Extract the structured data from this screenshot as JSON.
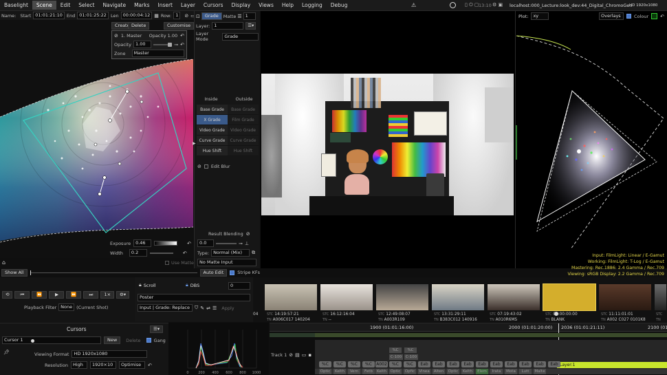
{
  "menu": [
    "Baselight",
    "Scene",
    "Edit",
    "Select",
    "Navigate",
    "Marks",
    "Insert",
    "Layer",
    "Cursors",
    "Display",
    "Views",
    "Help",
    "Logging",
    "Debug"
  ],
  "menu_active": "Scene",
  "status": {
    "time": "13:10",
    "host": "localhost:000_Lecture:look_dev:44_Digital_ChromoGen",
    "format": "HD 1920x1080"
  },
  "shotbar": {
    "name_label": "Name:",
    "start_label": "Start",
    "start": "01:01:21:10",
    "end_label": "End",
    "end": "01:01:25:22",
    "len_label": "Len",
    "len": "00:00:04:12",
    "row_label": "Row:",
    "row": "1"
  },
  "left": {
    "create": "Create",
    "delete": "Delete",
    "customise": "Customise",
    "master_label": "1. Master",
    "opacity_label": "Opacity 1.00",
    "opacity_field_label": "Opacity",
    "opacity": "1.00",
    "zone_label": "Zone",
    "zone": "Master",
    "exposure_label": "Exposure",
    "exposure": "0.46",
    "width_label": "Width",
    "width": "0.2",
    "use_matte": "Use Matte",
    "show_all": "Show All",
    "auto_edit": "Auto Edit",
    "stripe_kfs": "Stripe KFs"
  },
  "grade": {
    "tab_grade": "Grade",
    "tab_matte": "Matte",
    "layer_label": "Layer:",
    "layer": "1",
    "layer_mode_label": "Layer Mode",
    "layer_mode": "Grade",
    "layer_sel": "1",
    "inside": "Inside",
    "outside": "Outside",
    "rows": [
      [
        "Base Grade",
        "Base Grade"
      ],
      [
        "X Grade",
        "Film Grade"
      ],
      [
        "Video Grade",
        "Video Grade"
      ],
      [
        "Curve Grade",
        "Curve Grade"
      ],
      [
        "Hue Shift",
        "Hue Shift"
      ]
    ],
    "edit_blur": "Edit Blur",
    "result_blending": "Result Blending",
    "blend_value": "0.0",
    "type_label": "Type:",
    "type": "Normal (Mix)",
    "matte_input": "No Matte Input"
  },
  "plot": {
    "label": "Plot:",
    "mode": "xy",
    "overlays": "Overlays",
    "colour": "Colour",
    "legend": [
      "Input: FilmLight: Linear / E-Gamut",
      "Working: FilmLight: T-Log / E-Gamut",
      "Mastering: Rec.1886: 2.4 Gamma / Rec.709",
      "Viewing: sRGB Display: 2.2 Gamma / Rec.709"
    ],
    "legend_colors": [
      "#e6d84a",
      "#e6d84a",
      "#e6d84a",
      "#e6d84a"
    ]
  },
  "player": {
    "speed": "1×",
    "filter_label": "Playback Filter",
    "filter": "None",
    "filter_scope": "(Current Shot)"
  },
  "scroll": {
    "scroll": "Scroll",
    "dbs": "DBS",
    "dbs_value": "0",
    "poster": "Poster",
    "input_mode": "Input | Grade: Replace",
    "apply": "Apply"
  },
  "cursors": {
    "title": "Cursors",
    "cursor": "Cursor 1",
    "new": "New",
    "delete": "Delete",
    "gang": "Gang",
    "viewing_format_label": "Viewing Format",
    "viewing_format": "HD 1920x1080",
    "resolution_label": "Resolution",
    "resolution": "High",
    "resolution_value": "1920×10",
    "optimise": "Optimise"
  },
  "histogram": {
    "ticks": [
      "0",
      "200",
      "400",
      "600",
      "800",
      "1000"
    ]
  },
  "strip": [
    {
      "stc": "STC",
      "tc": "",
      "tn": "TN",
      "name": "04"
    },
    {
      "stc": "STC",
      "tc": "14:19:57:21",
      "tn": "TN",
      "name": "A006C017 140204"
    },
    {
      "stc": "STC",
      "tc": "16:12:16:04",
      "tn": "TN",
      "name": "--"
    },
    {
      "stc": "STC",
      "tc": "12:49:08:07",
      "tn": "TN",
      "name": "A003R109"
    },
    {
      "stc": "STC",
      "tc": "13:31:29:11",
      "tn": "TN",
      "name": "B383C012 140916"
    },
    {
      "stc": "STC",
      "tc": "07:19:43:02",
      "tn": "TN",
      "name": "A010R6MS"
    },
    {
      "stc": "STC",
      "tc": "00:00:00:00",
      "tn": "TN",
      "name": "BLANK"
    },
    {
      "stc": "STC",
      "tc": "11:11:01:01",
      "tn": "TN",
      "name": "A002 C027 0101K8"
    },
    {
      "stc": "STC",
      "tc": "",
      "tn": "TN",
      "name": ""
    }
  ],
  "timeline": {
    "marks": [
      "1900 (01:01:16:00)",
      "2000 (01:01:20:00)",
      "2036 (01:01:21:11)",
      "2100 (01:01"
    ],
    "track": "Track 1",
    "layer_label": "Layer:1",
    "chips": [
      "%C",
      "%C",
      "%C",
      "%C",
      "A002",
      "%C",
      "%C",
      "%C",
      "Eab",
      "Eab",
      "Eab",
      "Eab",
      "Eab",
      "Eab",
      "Eab",
      "Eab",
      "Eab",
      "Eab"
    ],
    "chips_top": [
      "%C",
      "%C"
    ],
    "chips_mid": [
      "C-100",
      "C-100"
    ],
    "sub": [
      "Optic",
      "Kelth",
      "Vern",
      "Fetb",
      "Kelth",
      "Optic",
      "Opfic",
      "Vinea",
      "Alten",
      "Optic",
      "Kelth",
      "Kelth",
      "Elem",
      "Irata",
      "Mota",
      "Lutt",
      "Malte"
    ]
  }
}
